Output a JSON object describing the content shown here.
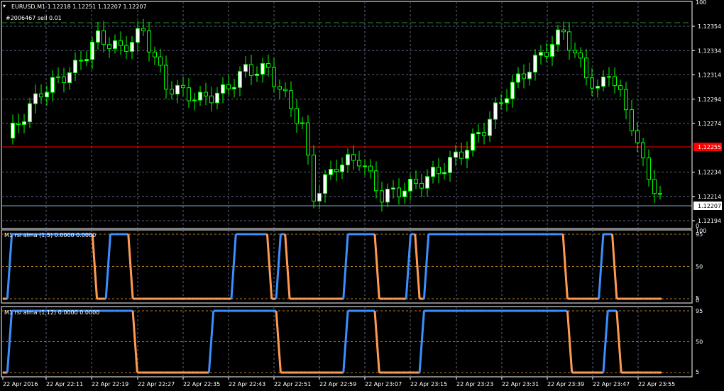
{
  "header": {
    "symbol_line": "EURUSD,M1  1.12218 1.12251 1.12207 1.12207",
    "order_label": "#2006467 sell 0.01"
  },
  "price_panel": {
    "price_ticks": [
      "1.12354",
      "1.12334",
      "1.12314",
      "1.12294",
      "1.12274",
      "1.12255",
      "1.12234",
      "1.12214",
      "1.12207",
      "1.12194"
    ],
    "sell_line_label": "1.12255",
    "current_price_label": "1.12207"
  },
  "indicators": [
    {
      "label": "M1 rsi alma (1,5) 0.0000 0.0000",
      "levels": [
        "100",
        "95",
        "50",
        "5",
        "0"
      ]
    },
    {
      "label": "M1 rsi alma (1,12) 0.0000 0.0000",
      "levels": [
        "100",
        "95",
        "50",
        "5",
        "0"
      ]
    }
  ],
  "time_axis": [
    "22 Apr 2016",
    "22 Apr 22:11",
    "22 Apr 22:19",
    "22 Apr 22:27",
    "22 Apr 22:35",
    "22 Apr 22:43",
    "22 Apr 22:51",
    "22 Apr 22:59",
    "22 Apr 23:07",
    "22 Apr 23:15",
    "22 Apr 23:23",
    "22 Apr 23:31",
    "22 Apr 23:39",
    "22 Apr 23:47",
    "22 Apr 23:55"
  ],
  "colors": {
    "background": "#000000",
    "grid": "#5a6480",
    "bull_candle": "#ffffff",
    "bear_candle": "#000000",
    "wick": "#00ff00",
    "sell_line": "#ff0000",
    "bid_line": "#7fa8c8",
    "sell_level": "#2a8c2a",
    "rsi_up": "#3d8fff",
    "rsi_down": "#ff9a52",
    "level_line": "#b08020"
  },
  "chart_data": [
    {
      "type": "candlestick",
      "title": "EURUSD,M1",
      "ohlc_last": {
        "open": 1.12218,
        "high": 1.12251,
        "low": 1.12207,
        "close": 1.12207
      },
      "ylim": [
        1.12194,
        1.12354
      ],
      "bid": 1.12207,
      "sell_order_price": 1.12255
    },
    {
      "type": "line",
      "name": "M1 rsi alma (1,5)",
      "ylim": [
        0,
        100
      ],
      "states": [
        0,
        0,
        1,
        1,
        1,
        1,
        1,
        1,
        1,
        1,
        1,
        1,
        1,
        1,
        1,
        1,
        1,
        1,
        1,
        1,
        1,
        0,
        0,
        0,
        1,
        1,
        1,
        1,
        1,
        0,
        0,
        0,
        0,
        0,
        0,
        0,
        0,
        0,
        0,
        0,
        0,
        0,
        0,
        0,
        0,
        0,
        0,
        0,
        0,
        0,
        0,
        0,
        1,
        1,
        1,
        1,
        1,
        1,
        1,
        1,
        0,
        0,
        1,
        1,
        0,
        0,
        0,
        0,
        0,
        0,
        0,
        0,
        0,
        0,
        0,
        0,
        0,
        1,
        1,
        1,
        1,
        1,
        1,
        1,
        0,
        0,
        0,
        0,
        0,
        0,
        0,
        1,
        1,
        0,
        0,
        1,
        1,
        1,
        1,
        1,
        1,
        1,
        1,
        1,
        1,
        1,
        1,
        1,
        1,
        1,
        1,
        1,
        1,
        1,
        1,
        1,
        1,
        1,
        1,
        1,
        1,
        1,
        1,
        1,
        1,
        1,
        0,
        0,
        0,
        0,
        0,
        0,
        0,
        0,
        1,
        1,
        1,
        0,
        0,
        0,
        0,
        0,
        0,
        0,
        0,
        0,
        0,
        0
      ]
    },
    {
      "type": "line",
      "name": "M1 rsi alma (1,12)",
      "ylim": [
        0,
        100
      ],
      "states": [
        0,
        0,
        1,
        1,
        1,
        1,
        1,
        1,
        1,
        1,
        1,
        1,
        1,
        1,
        1,
        1,
        1,
        1,
        1,
        1,
        1,
        1,
        1,
        1,
        1,
        1,
        1,
        1,
        1,
        1,
        0,
        0,
        0,
        0,
        0,
        0,
        0,
        0,
        0,
        0,
        0,
        0,
        0,
        0,
        0,
        0,
        0,
        1,
        1,
        1,
        1,
        1,
        1,
        1,
        1,
        1,
        1,
        1,
        1,
        1,
        1,
        1,
        0,
        0,
        0,
        0,
        0,
        0,
        0,
        0,
        0,
        0,
        0,
        0,
        0,
        0,
        0,
        1,
        1,
        1,
        1,
        1,
        1,
        1,
        0,
        0,
        0,
        0,
        0,
        0,
        0,
        0,
        0,
        0,
        1,
        1,
        1,
        1,
        1,
        1,
        1,
        1,
        1,
        1,
        1,
        1,
        1,
        1,
        1,
        1,
        1,
        1,
        1,
        1,
        1,
        1,
        1,
        1,
        1,
        1,
        1,
        1,
        1,
        1,
        1,
        1,
        1,
        0,
        0,
        0,
        0,
        0,
        0,
        0,
        0,
        1,
        1,
        1,
        0,
        0,
        0,
        0,
        0,
        0,
        0,
        0,
        0,
        0
      ]
    }
  ]
}
